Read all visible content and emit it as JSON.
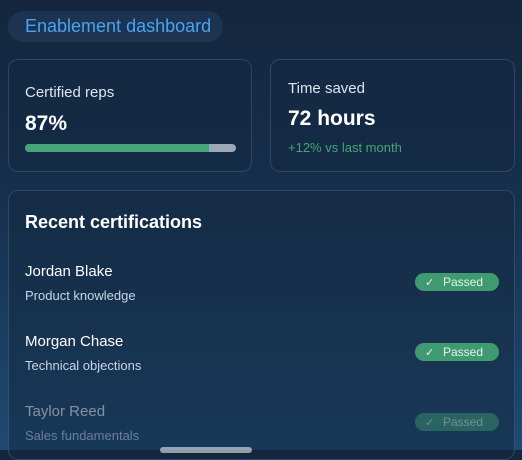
{
  "header": {
    "title": "Enablement dashboard"
  },
  "certified_card": {
    "label": "Certified reps",
    "value": "87%",
    "progress_fraction": 0.87,
    "progress_color": "#45a577"
  },
  "time_card": {
    "label": "Time saved",
    "value": "72 hours",
    "delta": "+12% vs last month"
  },
  "recent": {
    "title": "Recent certifications",
    "items": [
      {
        "name": "Jordan Blake",
        "topic": "Product knowledge",
        "status": "Passed"
      },
      {
        "name": "Morgan Chase",
        "topic": "Technical objections",
        "status": "Passed"
      },
      {
        "name": "Taylor Reed",
        "topic": "Sales fundamentals",
        "status": "Passed"
      }
    ]
  },
  "icons": {
    "status": "check-icon"
  },
  "colors": {
    "accent": "#4aa3f0",
    "success": "#45a577",
    "badge_bg": "#3f9a72"
  }
}
